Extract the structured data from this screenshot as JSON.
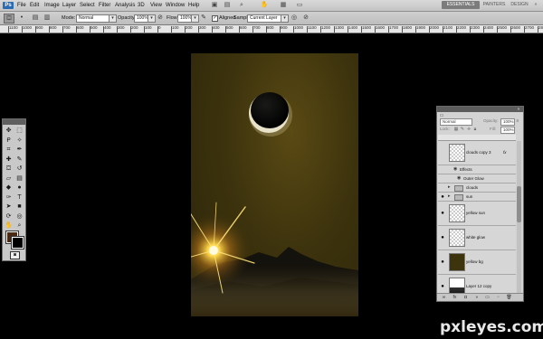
{
  "app": {
    "logo_text": "Ps",
    "menu": [
      "File",
      "Edit",
      "Image",
      "Layer",
      "Select",
      "Filter",
      "Analysis",
      "3D",
      "View",
      "Window",
      "Help"
    ],
    "workspaces": [
      "ESSENTIALS",
      "PAINTERS",
      "DESIGN"
    ],
    "zoom_icon": "zoom-icon"
  },
  "options": {
    "mode_label": "Mode:",
    "mode_value": "Normal",
    "opacity_label": "Opacity:",
    "opacity_value": "100%",
    "flow_label": "Flow:",
    "flow_value": "100%",
    "aligned_label": "Aligned",
    "aligned_checked": true,
    "sample_label": "Sample:",
    "sample_value": "Current Layer"
  },
  "ruler": {
    "labels": [
      "1100",
      "1000",
      "900",
      "800",
      "700",
      "600",
      "500",
      "400",
      "300",
      "200",
      "100",
      "0",
      "100",
      "200",
      "300",
      "400",
      "500",
      "600",
      "700",
      "800",
      "900",
      "1000",
      "1100",
      "1200",
      "1300",
      "1400",
      "1500",
      "1600",
      "1700",
      "1800",
      "1900",
      "2000",
      "2100",
      "2200",
      "2300",
      "2400",
      "2500",
      "2600",
      "2700",
      "2800"
    ]
  },
  "tools": {
    "icons": [
      "move-icon",
      "marquee-icon",
      "lasso-icon",
      "quick-select-icon",
      "crop-icon",
      "eyedropper-icon",
      "healing-icon",
      "brush-icon",
      "clone-stamp-icon",
      "history-brush-icon",
      "eraser-icon",
      "gradient-icon",
      "blur-icon",
      "dodge-icon",
      "pen-icon",
      "type-icon",
      "path-select-icon",
      "shape-icon",
      "3d-rotate-icon",
      "3d-orbit-icon",
      "hand-icon",
      "zoom-icon"
    ],
    "fg_color": "#4a2a12",
    "bg_color": "#000000"
  },
  "layers": {
    "blend_mode": "Normal",
    "opacity_label": "Opacity:",
    "opacity_value": "100%",
    "lock_label": "Lock:",
    "fill_label": "Fill:",
    "fill_value": "100%",
    "rows": [
      {
        "name": "clouds copy 3",
        "type": "layer",
        "visible": false,
        "fx": true
      },
      {
        "name": "Effects",
        "type": "effects",
        "visible": false
      },
      {
        "name": "Outer Glow",
        "type": "effect",
        "visible": false
      },
      {
        "name": "clouds",
        "type": "group",
        "visible": false
      },
      {
        "name": "sun",
        "type": "group",
        "visible": true
      },
      {
        "name": "yellow sun",
        "type": "layer",
        "visible": true
      },
      {
        "name": "white glow",
        "type": "layer",
        "visible": true
      },
      {
        "name": "yellow bg",
        "type": "layer",
        "visible": true
      },
      {
        "name": "Layer 12 copy",
        "type": "layer",
        "visible": true
      }
    ]
  },
  "watermark": "pxleyes.com"
}
